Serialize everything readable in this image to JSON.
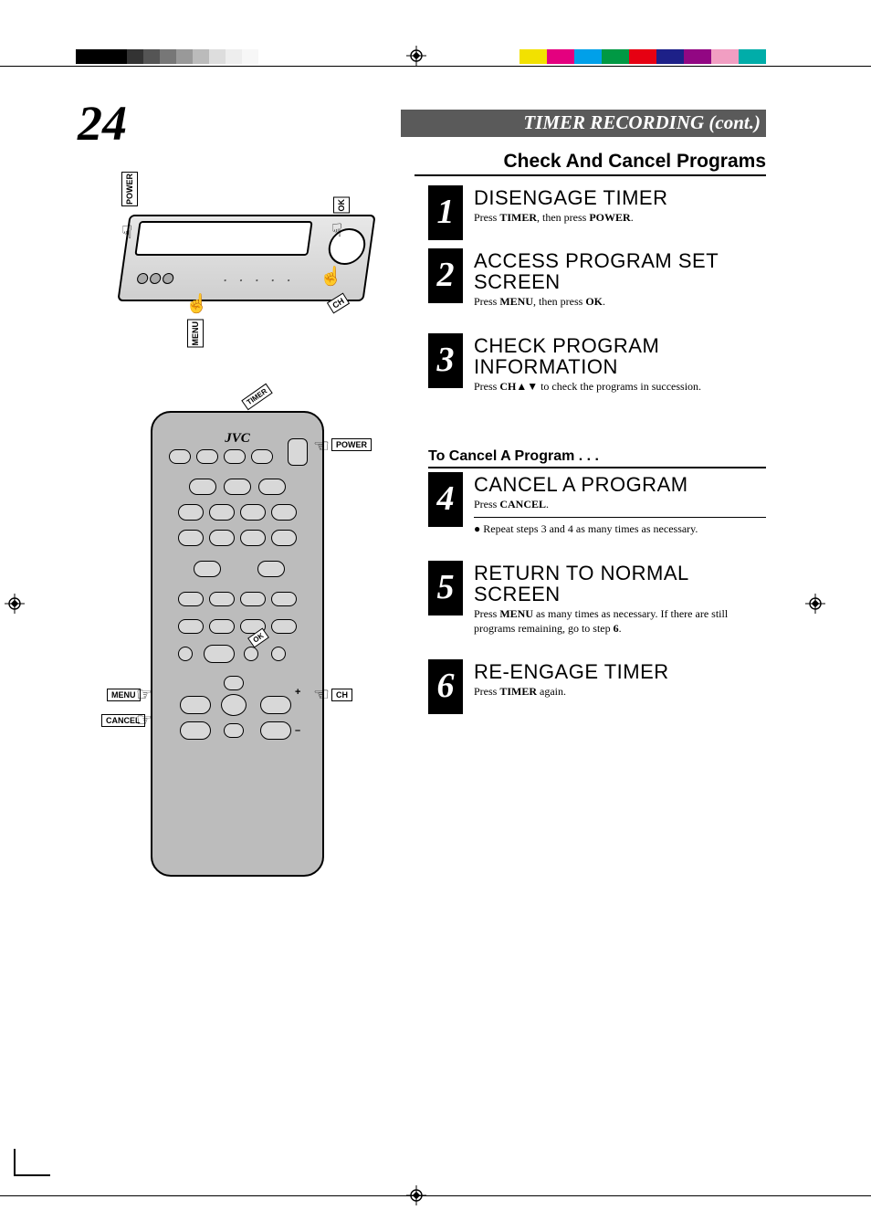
{
  "page_number": "24",
  "section_bar": "TIMER RECORDING (cont.)",
  "section_heading": "Check And Cancel Programs",
  "vcr_callouts": {
    "power": "POWER",
    "ok": "OK",
    "menu": "MENU",
    "ch": "CH"
  },
  "remote": {
    "brand": "JVC",
    "callouts": {
      "timer": "TIMER",
      "power": "POWER",
      "ok": "OK",
      "menu": "MENU",
      "ch": "CH",
      "cancel": "CANCEL",
      "plus": "+",
      "minus": "–"
    }
  },
  "steps_a": [
    {
      "num": "1",
      "title": "DISENGAGE TIMER",
      "body_parts": [
        "Press ",
        "TIMER",
        ", then press ",
        "POWER",
        "."
      ]
    },
    {
      "num": "2",
      "title": "ACCESS PROGRAM SET SCREEN",
      "body_parts": [
        "Press ",
        "MENU",
        ", then press ",
        "OK",
        "."
      ]
    },
    {
      "num": "3",
      "title": "CHECK PROGRAM INFORMATION",
      "body_parts": [
        "Press ",
        "CH",
        "▲▼ to check the programs in succession."
      ]
    }
  ],
  "subheading": "To Cancel A Program . . .",
  "steps_b": [
    {
      "num": "4",
      "title": "CANCEL A PROGRAM",
      "body_parts": [
        "Press ",
        "CANCEL",
        "."
      ],
      "bullet": "● Repeat steps 3 and 4 as many times as necessary."
    },
    {
      "num": "5",
      "title": "RETURN TO NORMAL SCREEN",
      "body_parts": [
        "Press ",
        "MENU",
        " as many times as necessary. If there are still programs remaining, go to step ",
        "6",
        "."
      ]
    },
    {
      "num": "6",
      "title": "RE-ENGAGE TIMER",
      "body_parts": [
        "Press ",
        "TIMER",
        " again."
      ]
    }
  ],
  "reg_colors": [
    "#f2e100",
    "#e4007f",
    "#00a0e9",
    "#009944",
    "#e60012",
    "#1d2088",
    "#920783",
    "#f19ec2",
    "#00ada9"
  ],
  "reg_grays": [
    "#333333",
    "#555555",
    "#777777",
    "#999999",
    "#bbbbbb",
    "#dddddd",
    "#eeeeee",
    "#f7f7f7"
  ]
}
